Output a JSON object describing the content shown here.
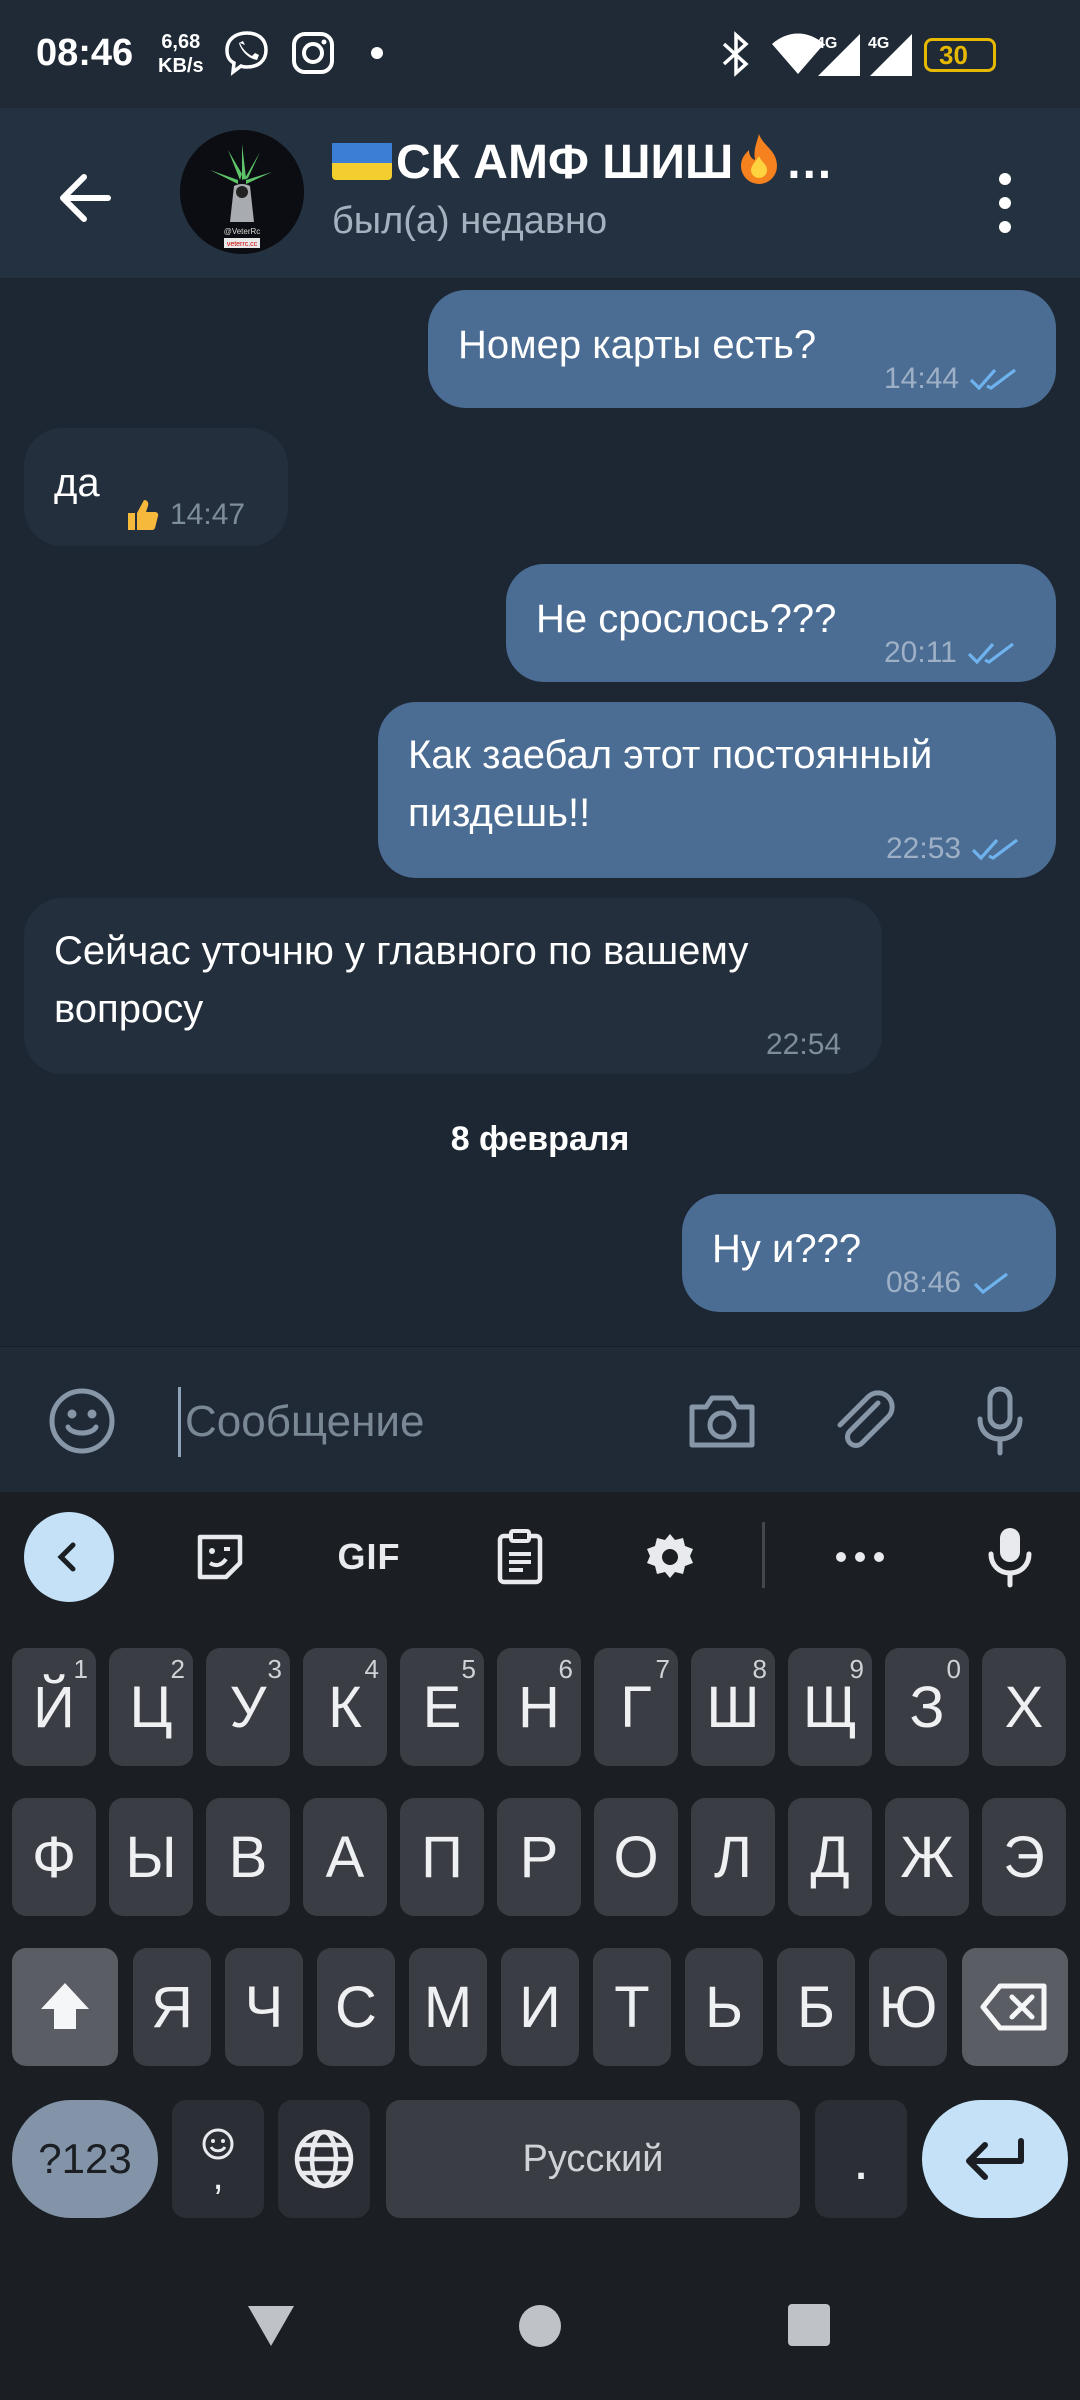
{
  "status_bar": {
    "time": "08:46",
    "speed_value": "6,68",
    "speed_unit": "KB/s",
    "battery": "30",
    "network_1": "4G",
    "network_2": "4G"
  },
  "header": {
    "title": "СК АМФ ШИШ",
    "title_suffix": "…",
    "subtitle": "был(а) недавно",
    "avatar_text_1": "@VeterRc",
    "avatar_text_2": "veterrc.cc"
  },
  "messages": [
    {
      "text": "Номер карты есть?",
      "time": "14:44",
      "direction": "out",
      "status": "read"
    },
    {
      "text": "да",
      "time": "14:47",
      "direction": "in",
      "reaction": "thumbs-up"
    },
    {
      "text": "Не срослось???",
      "time": "20:11",
      "direction": "out",
      "status": "read"
    },
    {
      "text_line1": "Как заебал этот постоянный",
      "text_line2": "пиздешь!!",
      "time": "22:53",
      "direction": "out",
      "status": "read"
    },
    {
      "text_line1": "Сейчас уточню у главного по вашему",
      "text_line2": "вопросу",
      "time": "22:54",
      "direction": "in"
    },
    {
      "text": "Ну и???",
      "time": "08:46",
      "direction": "out",
      "status": "sent"
    }
  ],
  "date_separator": "8 февраля",
  "input": {
    "placeholder": "Сообщение"
  },
  "keyboard": {
    "toolbar_gif": "GIF",
    "row1": [
      "Й",
      "Ц",
      "У",
      "К",
      "Е",
      "Н",
      "Г",
      "Ш",
      "Щ",
      "З",
      "Х"
    ],
    "row1_hints": [
      "1",
      "2",
      "3",
      "4",
      "5",
      "6",
      "7",
      "8",
      "9",
      "0",
      ""
    ],
    "row2": [
      "Ф",
      "Ы",
      "В",
      "А",
      "П",
      "Р",
      "О",
      "Л",
      "Д",
      "Ж",
      "Э"
    ],
    "row3": [
      "Я",
      "Ч",
      "С",
      "М",
      "И",
      "Т",
      "Ь",
      "Б",
      "Ю"
    ],
    "symbols": "?123",
    "comma": ",",
    "space": "Русский",
    "period": "."
  },
  "colors": {
    "accent": "#4b6c93",
    "incoming": "#232f3c",
    "check": "#6fb3ee"
  }
}
